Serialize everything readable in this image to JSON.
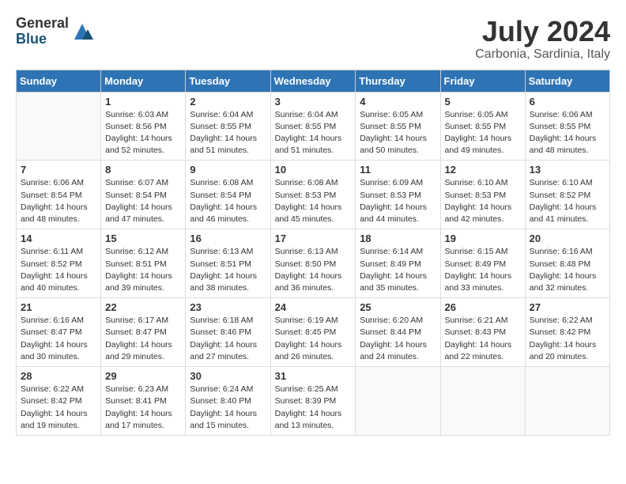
{
  "logo": {
    "general": "General",
    "blue": "Blue"
  },
  "title": {
    "month": "July 2024",
    "location": "Carbonia, Sardinia, Italy"
  },
  "headers": [
    "Sunday",
    "Monday",
    "Tuesday",
    "Wednesday",
    "Thursday",
    "Friday",
    "Saturday"
  ],
  "weeks": [
    [
      {
        "day": "",
        "info": ""
      },
      {
        "day": "1",
        "info": "Sunrise: 6:03 AM\nSunset: 8:56 PM\nDaylight: 14 hours\nand 52 minutes."
      },
      {
        "day": "2",
        "info": "Sunrise: 6:04 AM\nSunset: 8:55 PM\nDaylight: 14 hours\nand 51 minutes."
      },
      {
        "day": "3",
        "info": "Sunrise: 6:04 AM\nSunset: 8:55 PM\nDaylight: 14 hours\nand 51 minutes."
      },
      {
        "day": "4",
        "info": "Sunrise: 6:05 AM\nSunset: 8:55 PM\nDaylight: 14 hours\nand 50 minutes."
      },
      {
        "day": "5",
        "info": "Sunrise: 6:05 AM\nSunset: 8:55 PM\nDaylight: 14 hours\nand 49 minutes."
      },
      {
        "day": "6",
        "info": "Sunrise: 6:06 AM\nSunset: 8:55 PM\nDaylight: 14 hours\nand 48 minutes."
      }
    ],
    [
      {
        "day": "7",
        "info": "Sunrise: 6:06 AM\nSunset: 8:54 PM\nDaylight: 14 hours\nand 48 minutes."
      },
      {
        "day": "8",
        "info": "Sunrise: 6:07 AM\nSunset: 8:54 PM\nDaylight: 14 hours\nand 47 minutes."
      },
      {
        "day": "9",
        "info": "Sunrise: 6:08 AM\nSunset: 8:54 PM\nDaylight: 14 hours\nand 46 minutes."
      },
      {
        "day": "10",
        "info": "Sunrise: 6:08 AM\nSunset: 8:53 PM\nDaylight: 14 hours\nand 45 minutes."
      },
      {
        "day": "11",
        "info": "Sunrise: 6:09 AM\nSunset: 8:53 PM\nDaylight: 14 hours\nand 44 minutes."
      },
      {
        "day": "12",
        "info": "Sunrise: 6:10 AM\nSunset: 8:53 PM\nDaylight: 14 hours\nand 42 minutes."
      },
      {
        "day": "13",
        "info": "Sunrise: 6:10 AM\nSunset: 8:52 PM\nDaylight: 14 hours\nand 41 minutes."
      }
    ],
    [
      {
        "day": "14",
        "info": "Sunrise: 6:11 AM\nSunset: 8:52 PM\nDaylight: 14 hours\nand 40 minutes."
      },
      {
        "day": "15",
        "info": "Sunrise: 6:12 AM\nSunset: 8:51 PM\nDaylight: 14 hours\nand 39 minutes."
      },
      {
        "day": "16",
        "info": "Sunrise: 6:13 AM\nSunset: 8:51 PM\nDaylight: 14 hours\nand 38 minutes."
      },
      {
        "day": "17",
        "info": "Sunrise: 6:13 AM\nSunset: 8:50 PM\nDaylight: 14 hours\nand 36 minutes."
      },
      {
        "day": "18",
        "info": "Sunrise: 6:14 AM\nSunset: 8:49 PM\nDaylight: 14 hours\nand 35 minutes."
      },
      {
        "day": "19",
        "info": "Sunrise: 6:15 AM\nSunset: 8:49 PM\nDaylight: 14 hours\nand 33 minutes."
      },
      {
        "day": "20",
        "info": "Sunrise: 6:16 AM\nSunset: 8:48 PM\nDaylight: 14 hours\nand 32 minutes."
      }
    ],
    [
      {
        "day": "21",
        "info": "Sunrise: 6:16 AM\nSunset: 8:47 PM\nDaylight: 14 hours\nand 30 minutes."
      },
      {
        "day": "22",
        "info": "Sunrise: 6:17 AM\nSunset: 8:47 PM\nDaylight: 14 hours\nand 29 minutes."
      },
      {
        "day": "23",
        "info": "Sunrise: 6:18 AM\nSunset: 8:46 PM\nDaylight: 14 hours\nand 27 minutes."
      },
      {
        "day": "24",
        "info": "Sunrise: 6:19 AM\nSunset: 8:45 PM\nDaylight: 14 hours\nand 26 minutes."
      },
      {
        "day": "25",
        "info": "Sunrise: 6:20 AM\nSunset: 8:44 PM\nDaylight: 14 hours\nand 24 minutes."
      },
      {
        "day": "26",
        "info": "Sunrise: 6:21 AM\nSunset: 8:43 PM\nDaylight: 14 hours\nand 22 minutes."
      },
      {
        "day": "27",
        "info": "Sunrise: 6:22 AM\nSunset: 8:42 PM\nDaylight: 14 hours\nand 20 minutes."
      }
    ],
    [
      {
        "day": "28",
        "info": "Sunrise: 6:22 AM\nSunset: 8:42 PM\nDaylight: 14 hours\nand 19 minutes."
      },
      {
        "day": "29",
        "info": "Sunrise: 6:23 AM\nSunset: 8:41 PM\nDaylight: 14 hours\nand 17 minutes."
      },
      {
        "day": "30",
        "info": "Sunrise: 6:24 AM\nSunset: 8:40 PM\nDaylight: 14 hours\nand 15 minutes."
      },
      {
        "day": "31",
        "info": "Sunrise: 6:25 AM\nSunset: 8:39 PM\nDaylight: 14 hours\nand 13 minutes."
      },
      {
        "day": "",
        "info": ""
      },
      {
        "day": "",
        "info": ""
      },
      {
        "day": "",
        "info": ""
      }
    ]
  ]
}
